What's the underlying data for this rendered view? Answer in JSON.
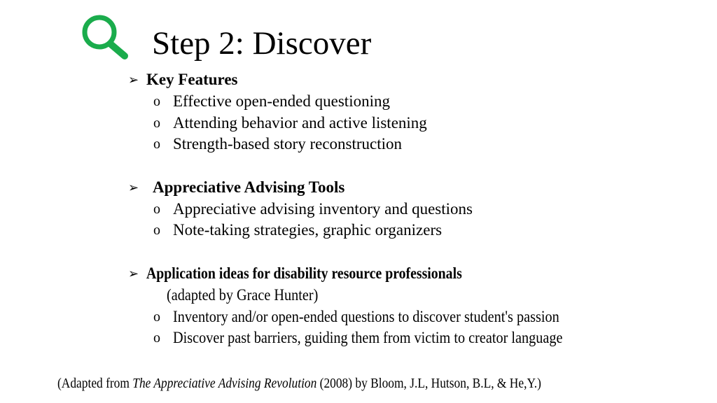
{
  "slide": {
    "title": "Step 2: Discover",
    "accent_color": "#1aac4c",
    "bullet_glyph": "➢",
    "sub_bullet_glyph": "o",
    "sections": [
      {
        "heading": "Key Features",
        "items": [
          "Effective open-ended questioning",
          "Attending behavior and active listening",
          "Strength-based story reconstruction"
        ]
      },
      {
        "heading": "Appreciative Advising Tools",
        "items": [
          "Appreciative advising inventory and questions",
          "Note-taking strategies, graphic organizers"
        ]
      },
      {
        "heading": "Application ideas for disability resource professionals",
        "note": "(adapted by Grace Hunter)",
        "items": [
          "Inventory and/or open-ended questions to discover student's passion",
          "Discover past barriers, guiding them from victim to creator language"
        ]
      }
    ],
    "citation": {
      "prefix": "(Adapted from ",
      "book_title": "The Appreciative Advising Revolution",
      "suffix": " (2008) by Bloom, J.L, Hutson, B.L, & He,Y.)"
    }
  }
}
